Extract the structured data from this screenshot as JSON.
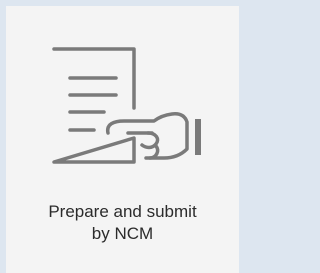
{
  "card": {
    "icon": "document-hand-submit-icon",
    "label_line1": "Prepare and submit",
    "label_line2": "by NCM"
  },
  "colors": {
    "background": "#dde6f0",
    "card": "#f4f4f4",
    "icon_stroke": "#7a7a7a",
    "text": "#2b2b2b"
  }
}
